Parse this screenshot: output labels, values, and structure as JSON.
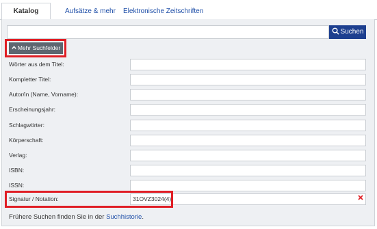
{
  "tabs": [
    {
      "label": "Katalog",
      "active": true
    },
    {
      "label": "Aufsätze & mehr",
      "active": false
    },
    {
      "label": "Elektronische Zeitschriften",
      "active": false
    }
  ],
  "search": {
    "value": "",
    "button_label": "Suchen",
    "button_icon": "search-icon"
  },
  "more_fields": {
    "label": "Mehr Suchfelder",
    "icon": "chevron-up-icon"
  },
  "fields": [
    {
      "label": "Wörter aus dem Titel:",
      "value": ""
    },
    {
      "label": "Kompletter Titel:",
      "value": ""
    },
    {
      "label": "Autor/in (Name, Vorname):",
      "value": ""
    },
    {
      "label": "Erscheinungsjahr:",
      "value": ""
    },
    {
      "label": "Schlagwörter:",
      "value": ""
    },
    {
      "label": "Körperschaft:",
      "value": ""
    },
    {
      "label": "Verlag:",
      "value": ""
    },
    {
      "label": "ISBN:",
      "value": ""
    },
    {
      "label": "ISSN:",
      "value": ""
    },
    {
      "label": "Signatur / Notation:",
      "value": "31OVZ3024(4)"
    }
  ],
  "history": {
    "prefix": "Frühere Suchen finden Sie in der ",
    "link": "Suchhistorie",
    "suffix": "."
  },
  "colors": {
    "accent": "#1d3f8f",
    "highlight": "#e01e25",
    "button_gray": "#5d6670",
    "panel_bg": "#eef0f3"
  }
}
